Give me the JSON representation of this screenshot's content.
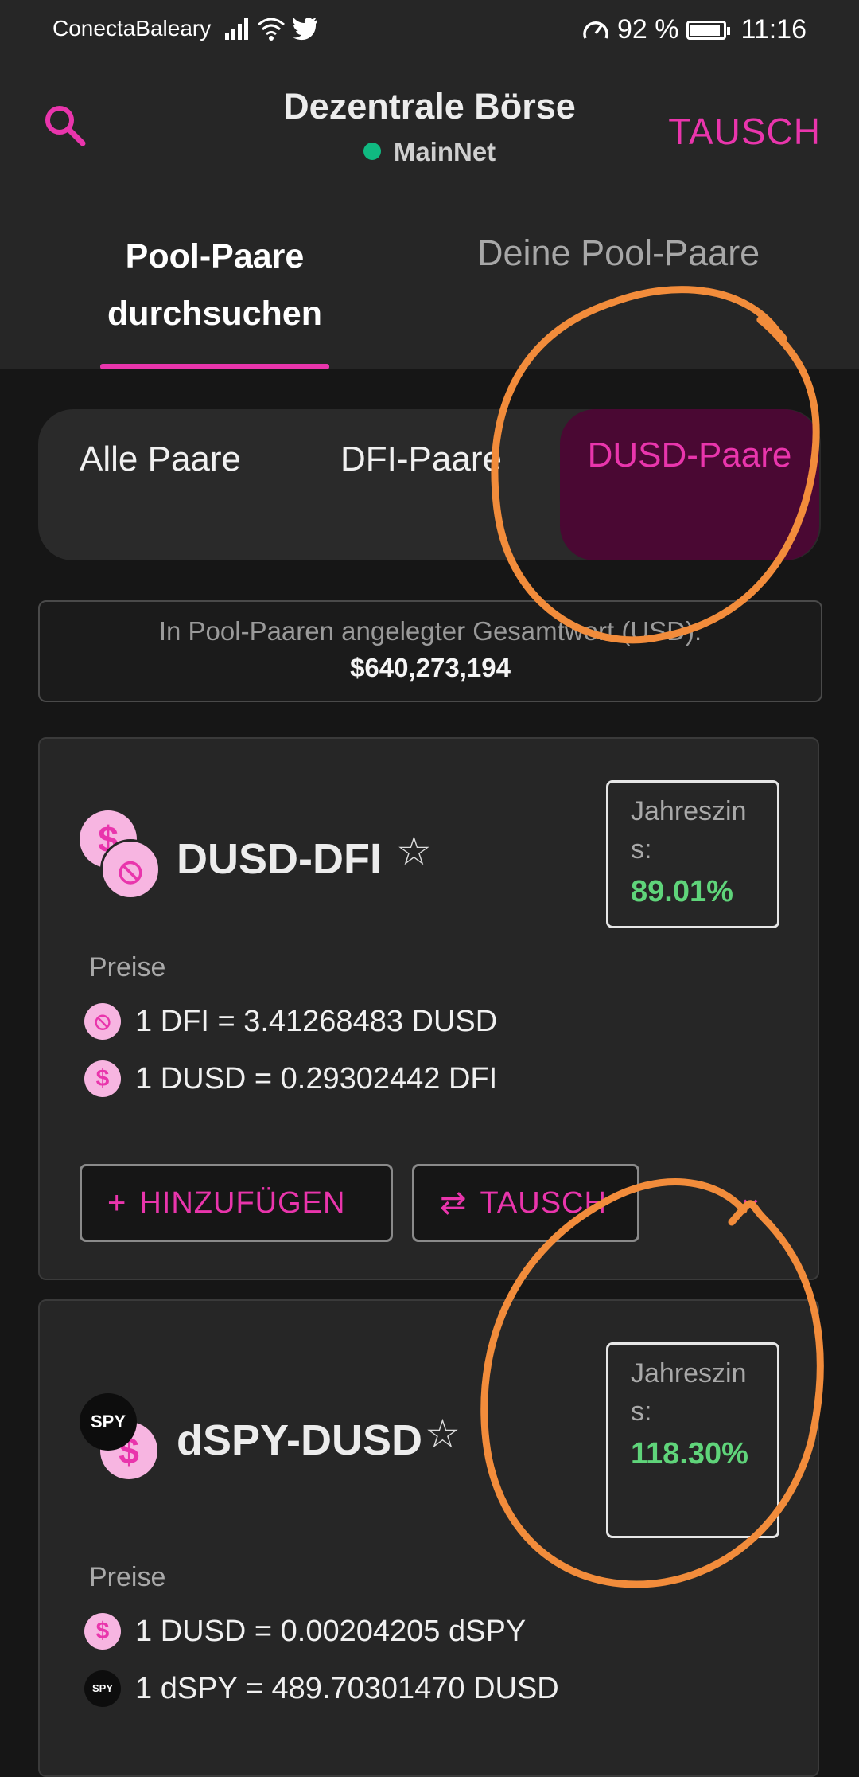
{
  "status_bar": {
    "carrier": "ConectaBaleary",
    "battery": "92 %",
    "time": "11:16",
    "battery_level": 0.92
  },
  "header": {
    "title": "Dezentrale Börse",
    "network": "MainNet",
    "swap_label": "TAUSCH"
  },
  "tabs": [
    {
      "label": "Pool-Paare durchsuchen",
      "active": true
    },
    {
      "label": "Deine Pool-Paare",
      "active": false
    }
  ],
  "filters": [
    {
      "label": "Alle Paare",
      "active": false
    },
    {
      "label": "DFI-Paare",
      "active": false
    },
    {
      "label": "DUSD-Paare",
      "active": true
    }
  ],
  "tvl": {
    "label": "In Pool-Paaren angelegter Gesamtwert (USD):",
    "value": "$640,273,194"
  },
  "pools": [
    {
      "name": "DUSD-DFI",
      "apr_label": "Jahreszins:",
      "apr_value": "89.01%",
      "prices_label": "Preise",
      "prices": [
        "1 DFI = 3.41268483 DUSD",
        "1 DUSD = 0.29302442 DFI"
      ],
      "add_label": "HINZUFÜGEN",
      "swap_label": "TAUSCH"
    },
    {
      "name": "dSPY-DUSD",
      "apr_label": "Jahreszins:",
      "apr_value": "118.30%",
      "prices_label": "Preise",
      "prices": [
        "1 DUSD = 0.00204205 dSPY",
        "1 dSPY = 489.70301470 DUSD"
      ],
      "spy_label": "SPY"
    }
  ],
  "colors": {
    "accent": "#e935ac",
    "positive": "#5fd47a",
    "annotation": "#f28c3b"
  }
}
